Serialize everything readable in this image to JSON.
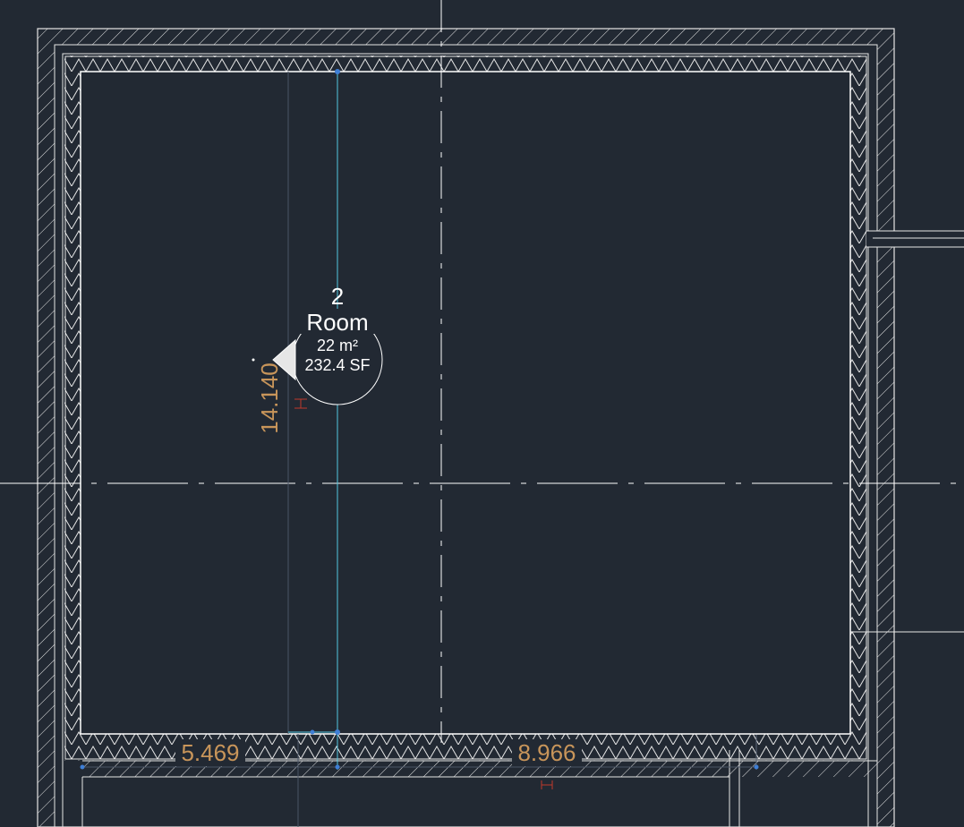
{
  "room": {
    "number": "2",
    "name": "Room",
    "area_metric": "22 m²",
    "area_imperial": "232.4 SF"
  },
  "dimensions": {
    "vertical": "14.140",
    "horizontal_left": "5.469",
    "horizontal_right": "8.966"
  },
  "colors": {
    "background": "#222933",
    "wall_line": "#e6e6e6",
    "centerline": "#ffffff",
    "selection": "#52c7e0",
    "grip": "#3f7fd6",
    "dimension_text": "#c8955a",
    "dimension_tick": "#c0392b"
  }
}
